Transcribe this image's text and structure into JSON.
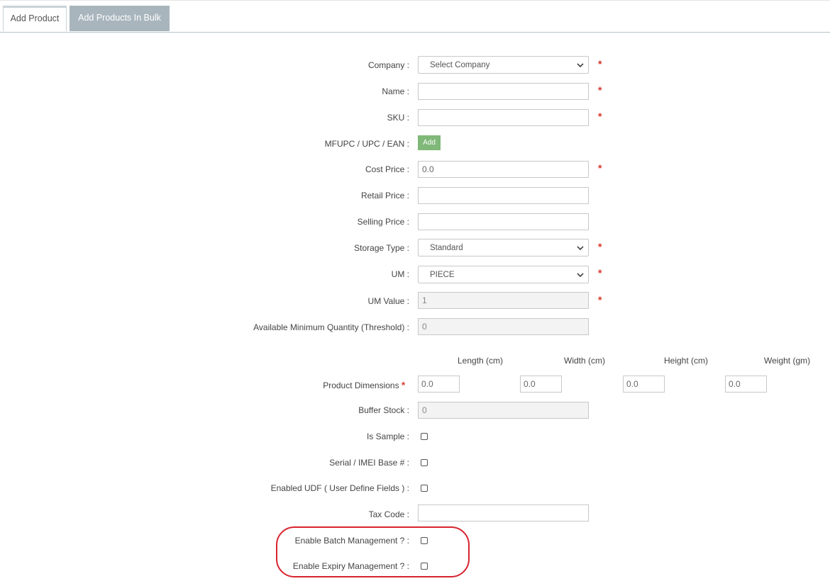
{
  "tabs": [
    {
      "label": "Add Product",
      "active": true
    },
    {
      "label": "Add Products In Bulk",
      "active": false
    }
  ],
  "form": {
    "company": {
      "label": "Company :",
      "value": "Select Company",
      "required": true
    },
    "name": {
      "label": "Name :",
      "value": "",
      "required": true
    },
    "sku": {
      "label": "SKU :",
      "value": "",
      "required": true
    },
    "mfupc": {
      "label": "MFUPC / UPC / EAN :",
      "button": "Add"
    },
    "cost_price": {
      "label": "Cost Price :",
      "value": "0.0",
      "required": true
    },
    "retail_price": {
      "label": "Retail Price :",
      "value": ""
    },
    "selling_price": {
      "label": "Selling Price :",
      "value": ""
    },
    "storage_type": {
      "label": "Storage Type :",
      "value": "Standard",
      "required": true
    },
    "um": {
      "label": "UM :",
      "value": "PIECE",
      "required": true
    },
    "um_value": {
      "label": "UM Value :",
      "value": "1",
      "required": true
    },
    "threshold": {
      "label": "Available Minimum Quantity (Threshold) :",
      "value": "0"
    },
    "dimensions": {
      "label": "Product Dimensions",
      "required_mark": "*",
      "headers": [
        "Length (cm)",
        "Width (cm)",
        "Height (cm)",
        "Weight (gm)"
      ],
      "values": [
        "0.0",
        "0.0",
        "0.0",
        "0.0"
      ]
    },
    "buffer_stock": {
      "label": "Buffer Stock :",
      "value": "0"
    },
    "is_sample": {
      "label": "Is Sample :",
      "checked": false
    },
    "serial_imei": {
      "label": "Serial / IMEI Base # :",
      "checked": false
    },
    "udf": {
      "label": "Enabled UDF ( User Define Fields ) :",
      "checked": false
    },
    "tax_code": {
      "label": "Tax Code :",
      "value": ""
    },
    "batch_mgmt": {
      "label": "Enable Batch Management ? :",
      "checked": false
    },
    "expiry_mgmt": {
      "label": "Enable Expiry Management ? :",
      "checked": false
    }
  },
  "required_mark": "*",
  "colors": {
    "required": "#d9342b",
    "add_button": "#7fb878",
    "highlight": "#d7242f",
    "inactive_tab": "#a9b5bd"
  }
}
